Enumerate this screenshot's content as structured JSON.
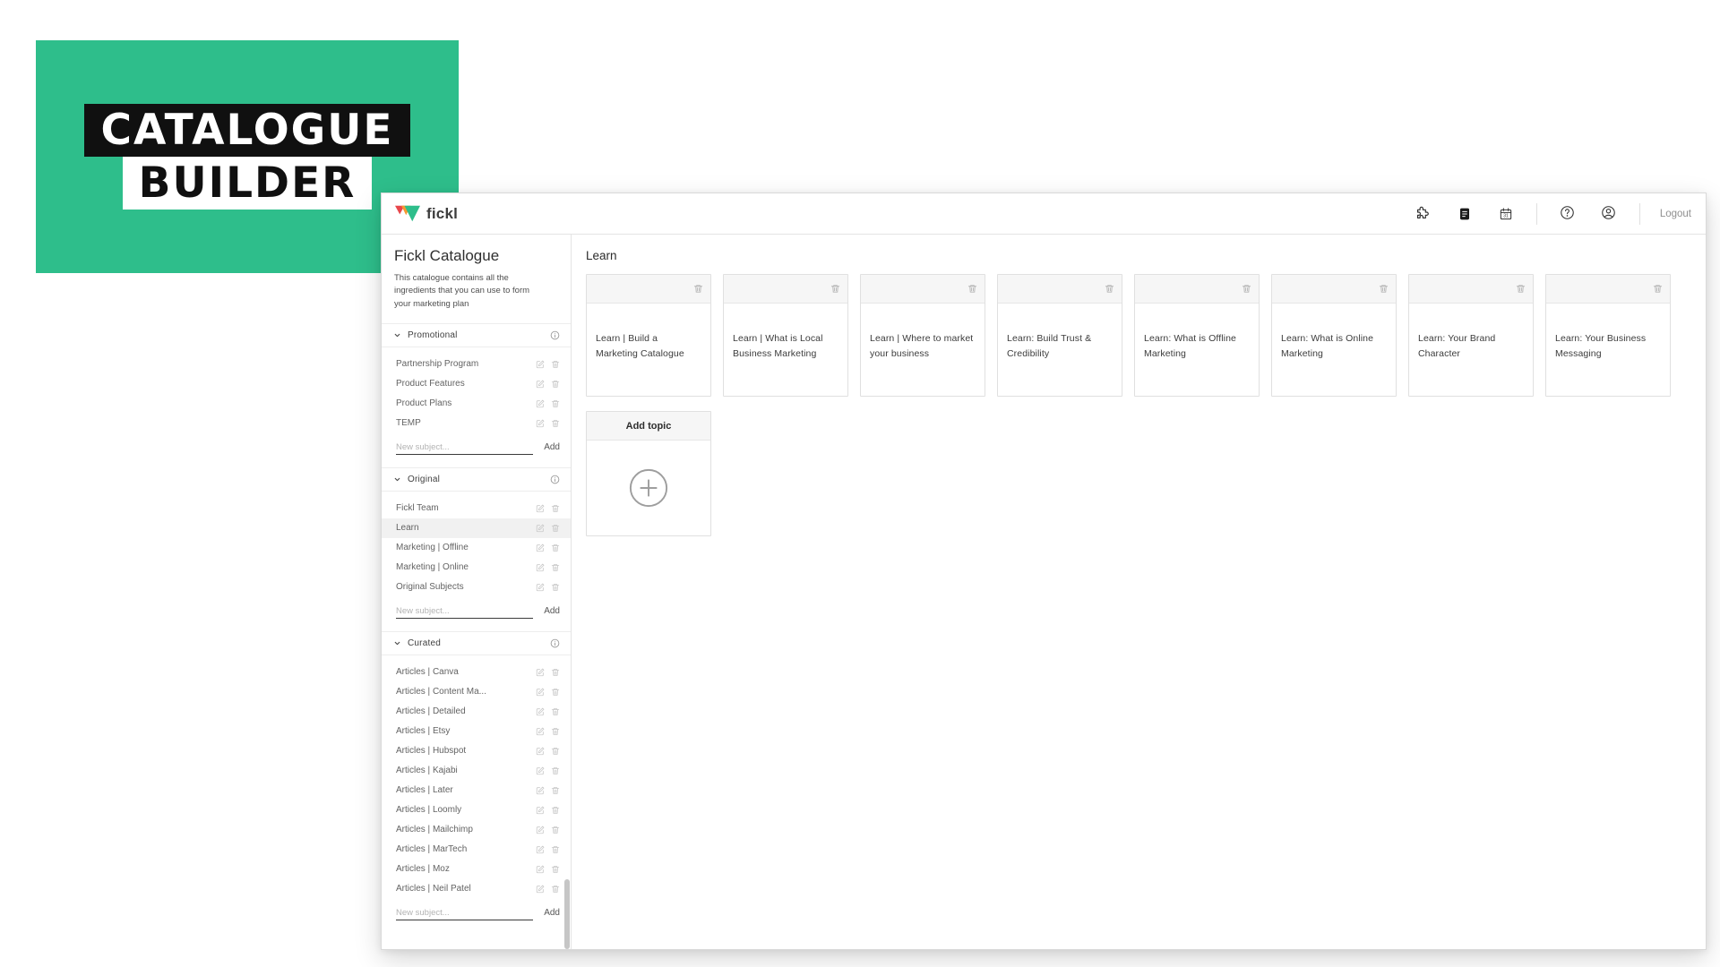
{
  "colors": {
    "brand_green": "#2ebe8b",
    "hero_black": "#101010",
    "logo_red": "#e8474b",
    "logo_orange": "#f59a32"
  },
  "hero": {
    "title_line1": "CATALOGUE",
    "title_line2": "BUILDER",
    "bg_color": "#2ebe8b"
  },
  "app": {
    "topbar": {
      "logo_text": "fickl",
      "logout_label": "Logout",
      "left_icons": [
        "puzzle-icon",
        "notes-icon",
        "calendar-icon"
      ],
      "right_icons": [
        "help-icon",
        "account-icon"
      ]
    },
    "sidebar": {
      "title": "Fickl Catalogue",
      "description": "This catalogue contains all the ingredients that you can use to form your marketing plan",
      "new_subject_placeholder": "New subject...",
      "add_label": "Add",
      "sections": [
        {
          "label": "Promotional",
          "selected": "",
          "items": [
            "Partnership Program",
            "Product Features",
            "Product Plans",
            "TEMP"
          ]
        },
        {
          "label": "Original",
          "selected": "Learn",
          "items": [
            "Fickl Team",
            "Learn",
            "Marketing | Offline",
            "Marketing | Online",
            "Original Subjects"
          ]
        },
        {
          "label": "Curated",
          "selected": "",
          "items": [
            "Articles | Canva",
            "Articles | Content Ma...",
            "Articles | Detailed",
            "Articles | Etsy",
            "Articles | Hubspot",
            "Articles | Kajabi",
            "Articles | Later",
            "Articles | Loomly",
            "Articles | Mailchimp",
            "Articles | MarTech",
            "Articles | Moz",
            "Articles | Neil Patel"
          ]
        }
      ]
    },
    "main": {
      "title": "Learn",
      "cards": [
        "Learn | Build a Marketing Catalogue",
        "Learn | What is Local Business Marketing",
        "Learn | Where to market your business",
        "Learn: Build Trust & Credibility",
        "Learn: What is Offline Marketing",
        "Learn: What is Online Marketing",
        "Learn: Your Brand Character",
        "Learn: Your Business Messaging"
      ],
      "add_topic_label": "Add topic"
    }
  }
}
